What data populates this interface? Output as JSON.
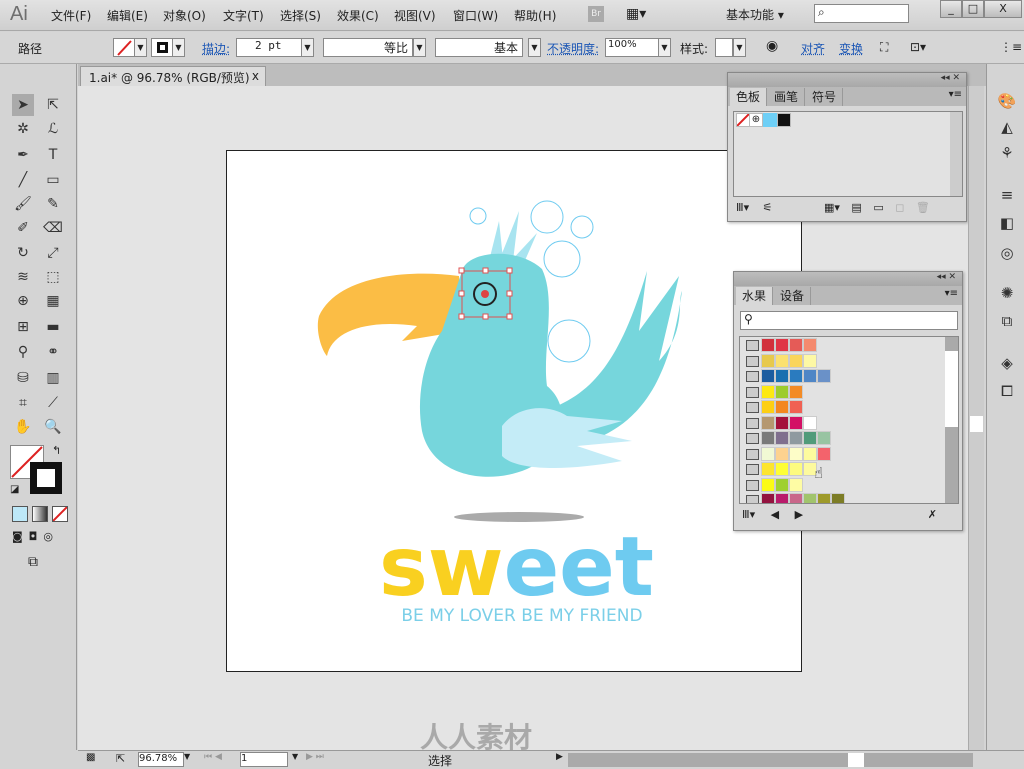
{
  "app": {
    "logo": "Ai",
    "menu": [
      "文件(F)",
      "编辑(E)",
      "对象(O)",
      "文字(T)",
      "选择(S)",
      "效果(C)",
      "视图(V)",
      "窗口(W)",
      "帮助(H)"
    ],
    "bridge": "Br",
    "workspace": "基本功能 ▾",
    "search_placeholder": "",
    "window_buttons": [
      "_",
      "□",
      "X"
    ]
  },
  "control": {
    "object_type": "路径",
    "stroke_label": "描边:",
    "stroke_weight": "2 pt",
    "profile": "等比",
    "brush": "基本",
    "opacity_label": "不透明度:",
    "opacity": "100%",
    "style_label": "样式:",
    "align": "对齐",
    "transform": "变换"
  },
  "document": {
    "tab": "1.ai* @ 96.78% (RGB/预览)",
    "close": "x"
  },
  "swatches_panel": {
    "tabs": [
      "色板",
      "画笔",
      "符号"
    ],
    "swatches": [
      "#ffffff",
      "#ffffff",
      "#6ecff6",
      "#111111"
    ]
  },
  "fruit_panel": {
    "tabs": [
      "水果",
      "设备"
    ],
    "search_value": "",
    "rows": [
      [
        "#d2303c",
        "#e03546",
        "#e55b57",
        "#f48a6e"
      ],
      [
        "#e7c94c",
        "#fbe170",
        "#fad55a",
        "#fdf8a5"
      ],
      [
        "#1c5da0",
        "#1a6fb0",
        "#2a7bbf",
        "#4f86c6",
        "#6a91c8"
      ],
      [
        "#fde913",
        "#9dcc2c",
        "#f38b25"
      ],
      [
        "#fdcf13",
        "#f3871f",
        "#f06153"
      ],
      [
        "#b59870",
        "#a4123c",
        "#d31065",
        "#ffffff"
      ],
      [
        "#7a7a7a",
        "#806f8e",
        "#8f9aa0",
        "#519b7a",
        "#98c4a2"
      ],
      [
        "#f1f9d4",
        "#fdd28f",
        "#fdfdc8",
        "#fdfb9e",
        "#f3636c"
      ],
      [
        "#fde52e",
        "#fefe35",
        "#fdfb7f",
        "#fdfa9e"
      ],
      [
        "#fbfb14",
        "#9fd02f",
        "#fefca4"
      ],
      [
        "#93133f",
        "#b91b6b",
        "#c9678a",
        "#a1c46c",
        "#9e9a2a",
        "#7d7d26"
      ]
    ]
  },
  "artwork": {
    "title": "sweet",
    "title_yellow": "sw",
    "title_blue": "eet",
    "subtitle": "BE MY LOVER BE MY FRIEND",
    "colors": {
      "beak": "#fbbd45",
      "body": "#76d6dc",
      "wing": "#c4ecf7",
      "yellow": "#f9d020",
      "blue": "#6ecbf0"
    }
  },
  "status": {
    "zoom": "96.78%",
    "artboard": "1",
    "tool": "选择"
  },
  "watermark": "人人素材"
}
